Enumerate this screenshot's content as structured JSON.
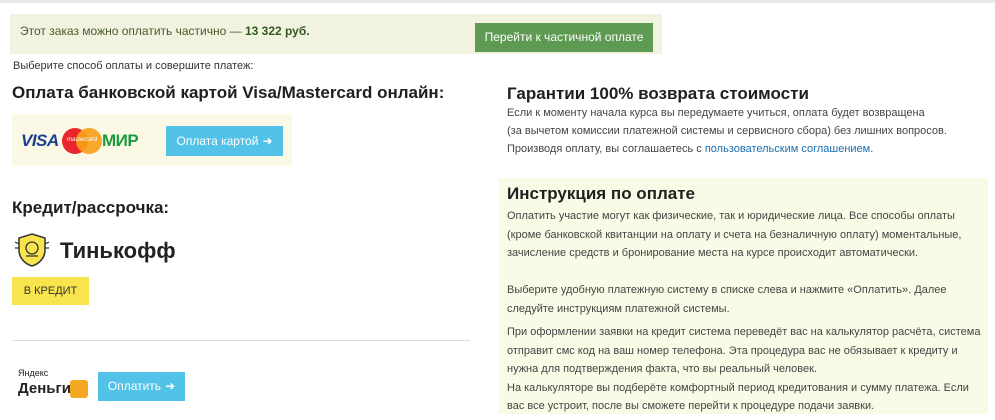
{
  "partial": {
    "text_prefix": "Этот заказ можно оплатить частично —",
    "amount": "13 322 руб.",
    "button": "Перейти к частичной оплате"
  },
  "choose_text": "Выберите способ оплаты и совершите платеж:",
  "card_section": {
    "title": "Оплата банковской картой Visa/Mastercard онлайн:",
    "logo_visa": "VISA",
    "logo_mastercard": "mastercard",
    "logo_mir": "МИР",
    "button": "Оплата картой",
    "button_icon": "arrow-right-icon"
  },
  "credit_section": {
    "title": "Кредит/рассрочка:",
    "bank_name": "Тинькофф",
    "button": "В КРЕДИТ"
  },
  "yandex": {
    "logo_small": "Яндекс",
    "logo_big": "Деньги",
    "button": "Оплатить",
    "button_icon": "arrow-right-icon"
  },
  "guarantee": {
    "title": "Гарантии 100% возврата стоимости",
    "line1": "Если к моменту начала курса вы передумаете учиться, оплата будет возвращена",
    "line2": "(за вычетом комиссии платежной системы и сервисного сбора) без лишних вопросов.",
    "line3_prefix": "Производя оплату, вы соглашаетесь с",
    "line3_link": "пользовательским соглашением",
    "line3_suffix": "."
  },
  "instruction": {
    "title": "Инструкция по оплате",
    "p1": "Оплатить участие могут как физические, так и юридические лица. Все способы оплаты (кроме банковской квитанции на оплату и счета на безналичную оплату) моментальные, зачисление средств и бронирование места на курсе происходит автоматически.",
    "p2": "Выберите удобную платежную систему в списке слева и нажмите «Оплатить». Далее следуйте инструкциям платежной системы.",
    "p3_a": "При оформлении заявки на кредит система переведёт вас на калькулятор расчёта, система отправит смс код на ваш номер телефона. Эта процедура вас не обязывает к кредиту и нужна для подтверждения факта, что вы реальный человек.",
    "p3_b": "На калькуляторе вы подберёте комфортный период кредитования и сумму платежа. Если вас все устроит, после вы сможете перейти к процедуре подачи заявки."
  },
  "colors": {
    "partial_bg": "#f1f3e0",
    "green_button": "#5e9a52",
    "blue_button": "#52c2e9",
    "yellow_button": "#f8e54d",
    "instruction_bg": "#fafbe6",
    "link": "#1a6fb0"
  }
}
